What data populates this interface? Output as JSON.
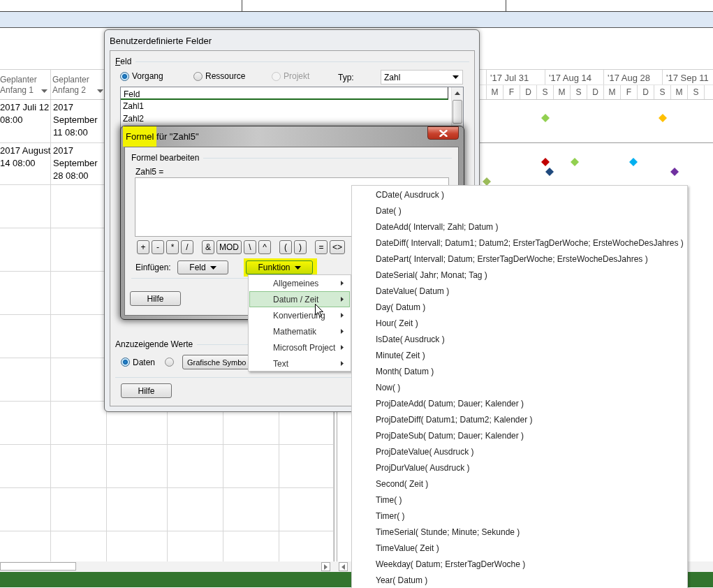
{
  "table": {
    "columns": [
      {
        "label": "Geplanter Anfang 1"
      },
      {
        "label": "Geplanter Anfang 2"
      }
    ],
    "rows": [
      {
        "cells": [
          [
            "2017 Juli 12",
            "08:00"
          ],
          [
            "2017",
            "September",
            "11 08:00"
          ]
        ]
      },
      {
        "cells": [
          [
            "2017 August",
            "14 08:00"
          ],
          [
            "2017",
            "September",
            "28 08:00"
          ]
        ]
      }
    ]
  },
  "gantt": {
    "major": [
      "'17 Jul 31",
      "'17 Aug 14",
      "'17 Aug 28",
      "'17 Sep 11"
    ],
    "minor": [
      "M",
      "F",
      "D",
      "S",
      "M",
      "S",
      "D",
      "M",
      "F",
      "D",
      "S",
      "M",
      "S"
    ],
    "rows": [
      {
        "milestones": [
          {
            "color": "#92d050"
          },
          {
            "color": "#ffc000"
          }
        ]
      },
      {
        "milestones": [
          {
            "color": "#c00000"
          },
          {
            "color": "#92d050"
          },
          {
            "color": "#00b0f0"
          },
          {
            "color": "#1f497d"
          },
          {
            "color": "#7030a0"
          },
          {
            "color": "#9bbb59"
          }
        ]
      }
    ]
  },
  "custom_fields_dialog": {
    "title": "Benutzerdefinierte Felder",
    "field_group": "Feld",
    "scope_options": [
      {
        "label": "Vorgang",
        "selected": true,
        "disabled": false
      },
      {
        "label": "Ressource",
        "selected": false,
        "disabled": false
      },
      {
        "label": "Projekt",
        "selected": false,
        "disabled": true
      }
    ],
    "type_label": "Typ:",
    "type_value": "Zahl",
    "field_list": {
      "header": "Feld",
      "items": [
        "Zahl1",
        "Zahl2"
      ]
    },
    "display_group": "Anzuzeigende Werte",
    "display_options": [
      {
        "label": "Daten",
        "selected": true
      },
      {
        "selected": false
      }
    ],
    "symbols_button": "Grafische Symbo",
    "help_button": "Hilfe"
  },
  "formula_dialog": {
    "title": "Formel für \"Zahl5\"",
    "title_highlighted": true,
    "group": "Formel bearbeiten",
    "formula_label": "Zahl5 =",
    "operator_groups": [
      [
        "+",
        "-",
        "*",
        "/"
      ],
      [
        "&",
        "MOD",
        "\\",
        "^"
      ],
      [
        "(",
        ")"
      ],
      [
        "=",
        "<>"
      ]
    ],
    "insert_label": "Einfügen:",
    "field_button": "Feld",
    "function_button": {
      "label": "Funktion",
      "highlighted": true
    },
    "help_button": "Hilfe"
  },
  "function_menu": {
    "items": [
      {
        "label": "Allgemeines",
        "selected": false
      },
      {
        "label": "Datum / Zeit",
        "selected": true
      },
      {
        "label": "Konvertierung",
        "selected": false
      },
      {
        "label": "Mathematik",
        "selected": false
      },
      {
        "label": "Microsoft Project",
        "selected": false
      },
      {
        "label": "Text",
        "selected": false
      }
    ]
  },
  "date_time_submenu": {
    "items": [
      "CDate( Ausdruck )",
      "Date( )",
      "DateAdd( Intervall; Zahl; Datum )",
      "DateDiff( Intervall; Datum1; Datum2; ErsterTagDerWoche; ErsteWocheDesJahres )",
      "DatePart( Intervall; Datum; ErsterTagDerWoche; ErsteWocheDesJahres )",
      "DateSerial( Jahr; Monat; Tag )",
      "DateValue( Datum )",
      "Day( Datum )",
      "Hour( Zeit )",
      "IsDate( Ausdruck )",
      "Minute( Zeit )",
      "Month( Datum )",
      "Now( )",
      "ProjDateAdd( Datum; Dauer; Kalender )",
      "ProjDateDiff( Datum1; Datum2; Kalender )",
      "ProjDateSub( Datum; Dauer; Kalender )",
      "ProjDateValue( Ausdruck )",
      "ProjDurValue( Ausdruck )",
      "Second( Zeit )",
      "Time( )",
      "Timer( )",
      "TimeSerial( Stunde; Minute; Sekunde )",
      "TimeValue( Zeit )",
      "Weekday( Datum; ErsterTagDerWoche )",
      "Year( Datum )"
    ]
  }
}
